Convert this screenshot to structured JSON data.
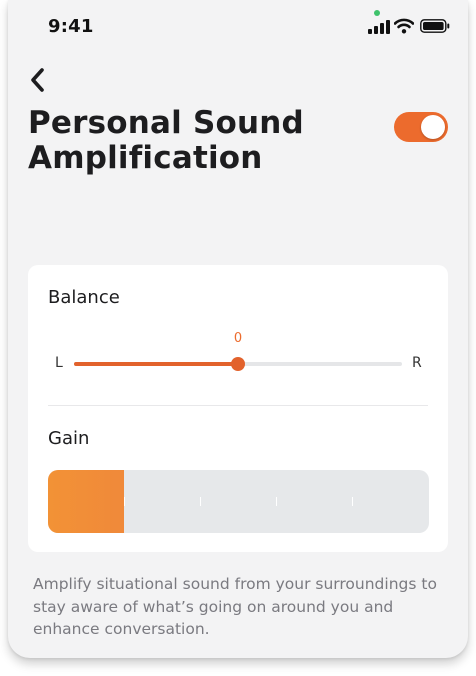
{
  "status_bar": {
    "time": "9:41"
  },
  "header": {
    "back_icon": "chevron-left-icon",
    "title": "Personal Sound Amplification",
    "toggle_on": true
  },
  "balance": {
    "label": "Balance",
    "value": "0",
    "left_label": "L",
    "right_label": "R",
    "position_fraction": 0.5
  },
  "gain": {
    "label": "Gain",
    "level_fraction": 0.2
  },
  "description": "Amplify situational sound from your surroundings to stay aware of what’s going on around you and enhance conversation.",
  "colors": {
    "accent": "#ec6b2d",
    "status_dot": "#3ec26b"
  }
}
